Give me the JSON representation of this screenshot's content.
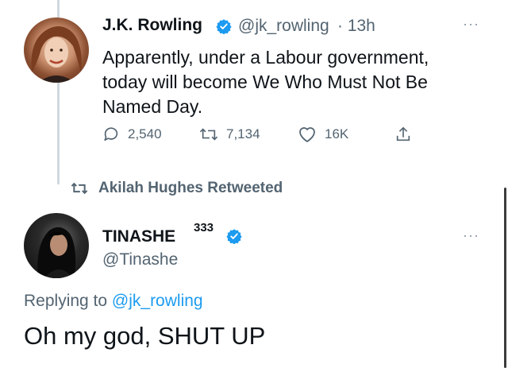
{
  "tweet": {
    "author_name": "J.K. Rowling",
    "handle": "@jk_rowling",
    "time": "· 13h",
    "lines": [
      "Apparently, under a Labour government,",
      "today will become We Who Must Not Be",
      "Named Day."
    ],
    "replies": "2,540",
    "retweets": "7,134",
    "likes": "16K"
  },
  "retweet_banner": "Akilah Hughes Retweeted",
  "reply": {
    "author_name": "TINASHE",
    "superscript": "333",
    "handle": "@Tinashe",
    "replying_prefix": "Replying to",
    "replying_to": "@jk_rowling",
    "text": "Oh my god, SHUT UP"
  },
  "more_glyph": "···",
  "colors": {
    "accent": "#1d9bf0",
    "muted": "#536471",
    "line": "#cfd9de"
  }
}
